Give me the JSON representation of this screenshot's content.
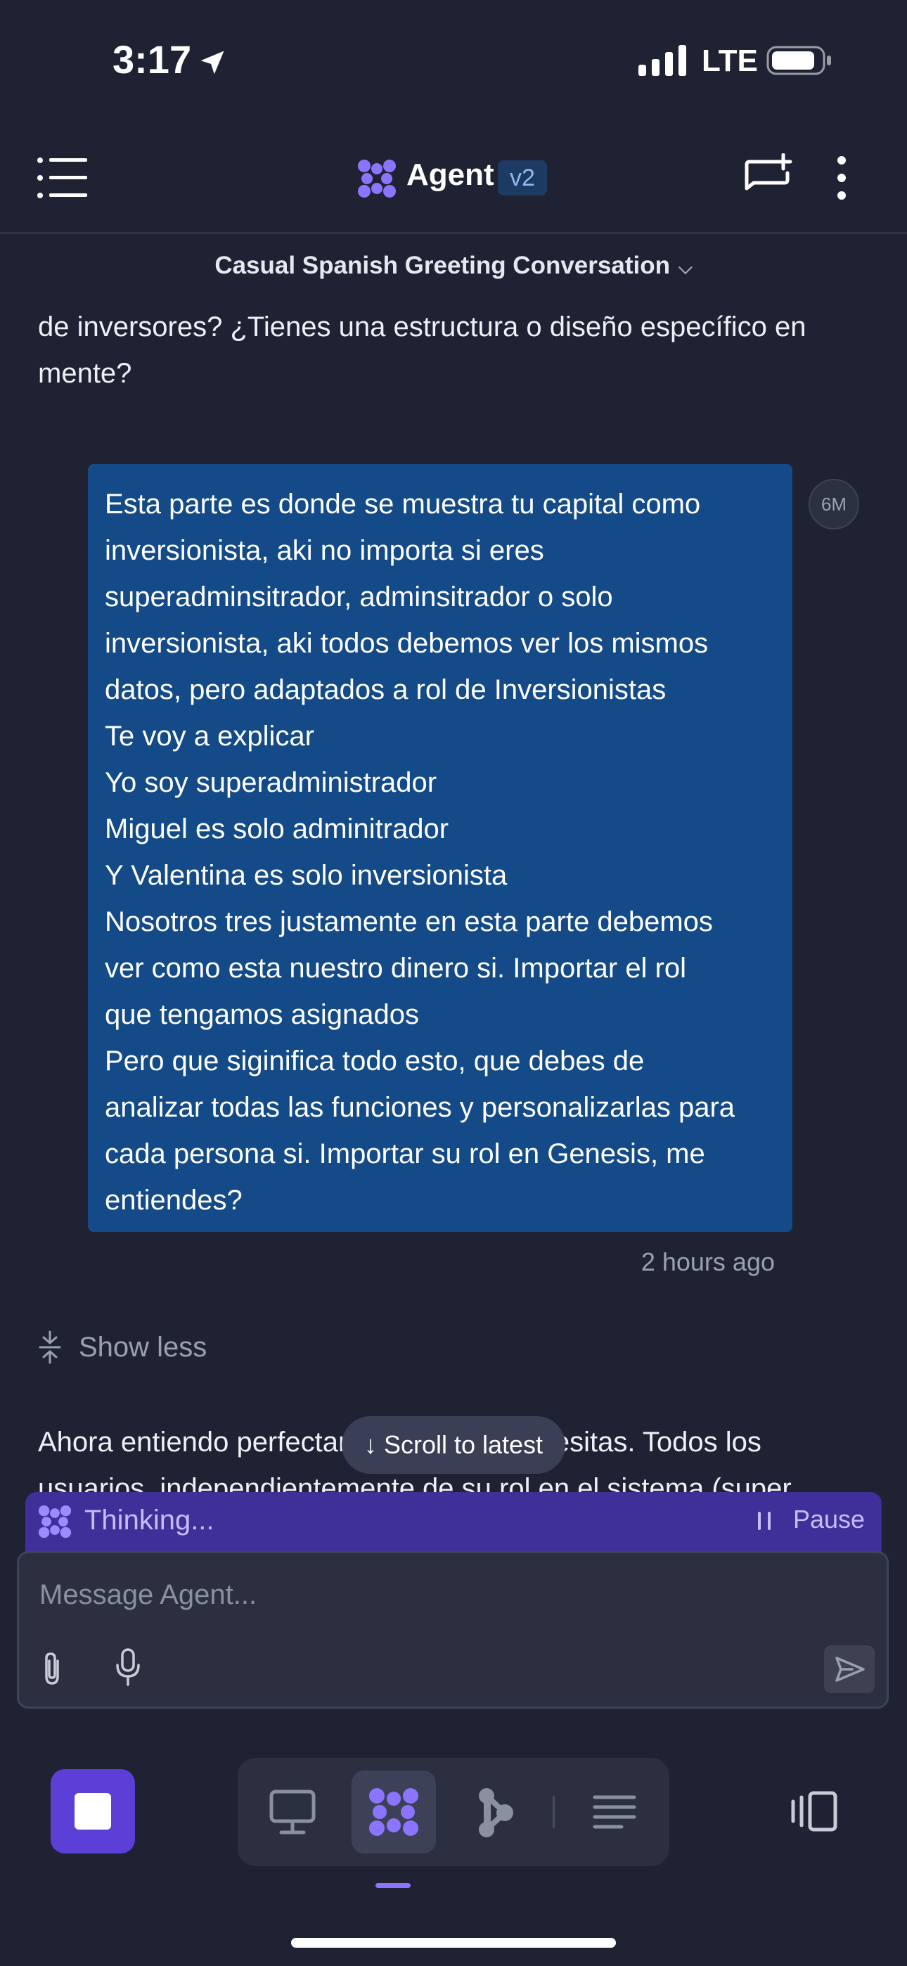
{
  "status_bar": {
    "time": "3:17",
    "network": "LTE"
  },
  "header": {
    "agent_name": "Agent",
    "version": "v2",
    "conversation_title": "Casual Spanish Greeting Conversation"
  },
  "messages": {
    "previous_assistant": {
      "lines": [
        "de inversores? ¿Tienes una estructura o diseño específico en",
        "mente?"
      ]
    },
    "user": {
      "avatar_label": "6M",
      "lines": [
        "Esta parte es donde se muestra tu capital como",
        "inversionista, aki no importa si eres",
        "superadminsitrador, adminsitrador o solo",
        "inversionista, aki todos debemos ver los mismos",
        "datos, pero adaptados a rol de Inversionistas",
        "Te voy a explicar",
        "Yo soy superadministrador",
        "Miguel es solo adminitrador",
        "Y Valentina es solo inversionista",
        "Nosotros tres justamente en esta parte debemos",
        "ver como esta nuestro dinero si. Importar el rol",
        "que tengamos asignados",
        "Pero que siginifica todo esto, que debes de",
        "analizar todas las funciones y personalizarlas para",
        "cada persona si. Importar su rol en Genesis, me",
        "entiendes?"
      ],
      "timestamp": "2 hours ago"
    },
    "show_less_label": "Show less",
    "assistant_reply": {
      "lines": [
        "Ahora entiendo perfectamente lo que necesitas. Todos los",
        "usuarios, independientemente de su rol en el sistema (super"
      ]
    }
  },
  "scroll_to_latest": "Scroll to latest",
  "thinking_bar": {
    "label": "Thinking...",
    "pause_label": "Pause"
  },
  "composer": {
    "placeholder": "Message Agent..."
  },
  "icons": {
    "menu": "menu-icon",
    "agent_logo": "agent-logo-icon",
    "new_chat": "new-chat-icon",
    "more": "more-vertical-icon",
    "attach": "paperclip-icon",
    "mic": "microphone-icon",
    "send": "send-icon",
    "stop": "stop-icon",
    "desktop": "desktop-icon",
    "agent_tab": "agent-icon",
    "graph": "graph-icon",
    "lines": "lines-icon",
    "panel": "panel-icon"
  },
  "colors": {
    "background": "#1f2232",
    "user_bubble": "#134a87",
    "thinking_bar": "#3e2f99",
    "accent_purple": "#5b3fd6",
    "logo_purple": "#8b74ff"
  }
}
